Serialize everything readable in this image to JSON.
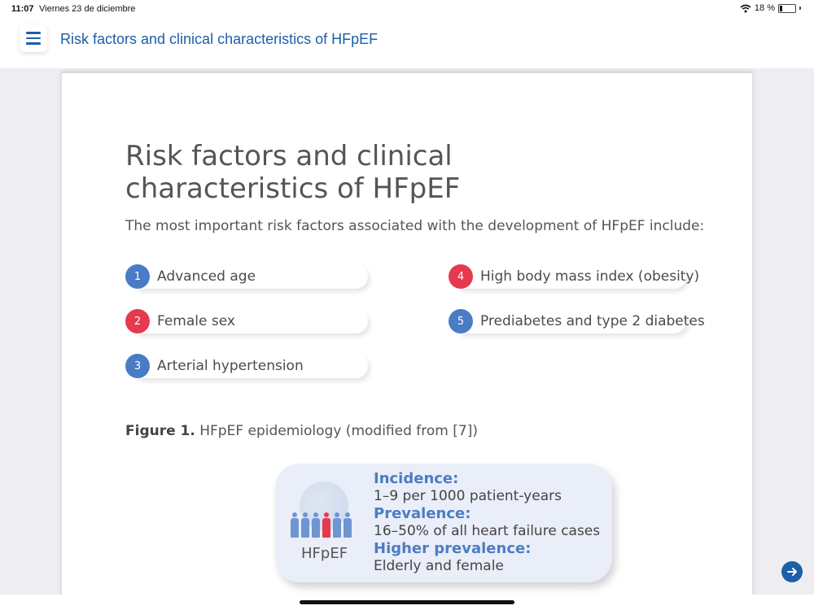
{
  "status_bar": {
    "time": "11:07",
    "date": "Viernes 23 de diciembre",
    "battery": "18 %"
  },
  "header": {
    "title": "Risk factors and clinical characteristics of HFpEF"
  },
  "document": {
    "title": "Risk factors and clinical characteristics of HFpEF",
    "intro": "The most important risk factors associated with the development of HFpEF include:",
    "risk_factors": [
      {
        "num": "1",
        "label": "Advanced age",
        "color": "#4a7bc6"
      },
      {
        "num": "2",
        "label": "Female sex",
        "color": "#e5394e"
      },
      {
        "num": "3",
        "label": "Arterial hypertension",
        "color": "#4a7bc6"
      },
      {
        "num": "4",
        "label": "High body mass index (obesity)",
        "color": "#e5394e"
      },
      {
        "num": "5",
        "label": "Prediabetes and type 2 diabetes",
        "color": "#4a7bc6"
      }
    ],
    "figure": {
      "caption_bold": "Figure 1.",
      "caption_text": " HFpEF epidemiology (modified from [7])",
      "label": "HFpEF",
      "incidence_h": "Incidence:",
      "incidence_v": "1–9 per 1000 patient-years",
      "prevalence_h": "Prevalence:",
      "prevalence_v": "16–50% of all heart failure cases",
      "higher_h": "Higher prevalence:",
      "higher_v": "Elderly and female"
    }
  },
  "colors": {
    "accent": "#1b5fa8",
    "blue": "#4a7bc6",
    "red": "#e5394e"
  }
}
